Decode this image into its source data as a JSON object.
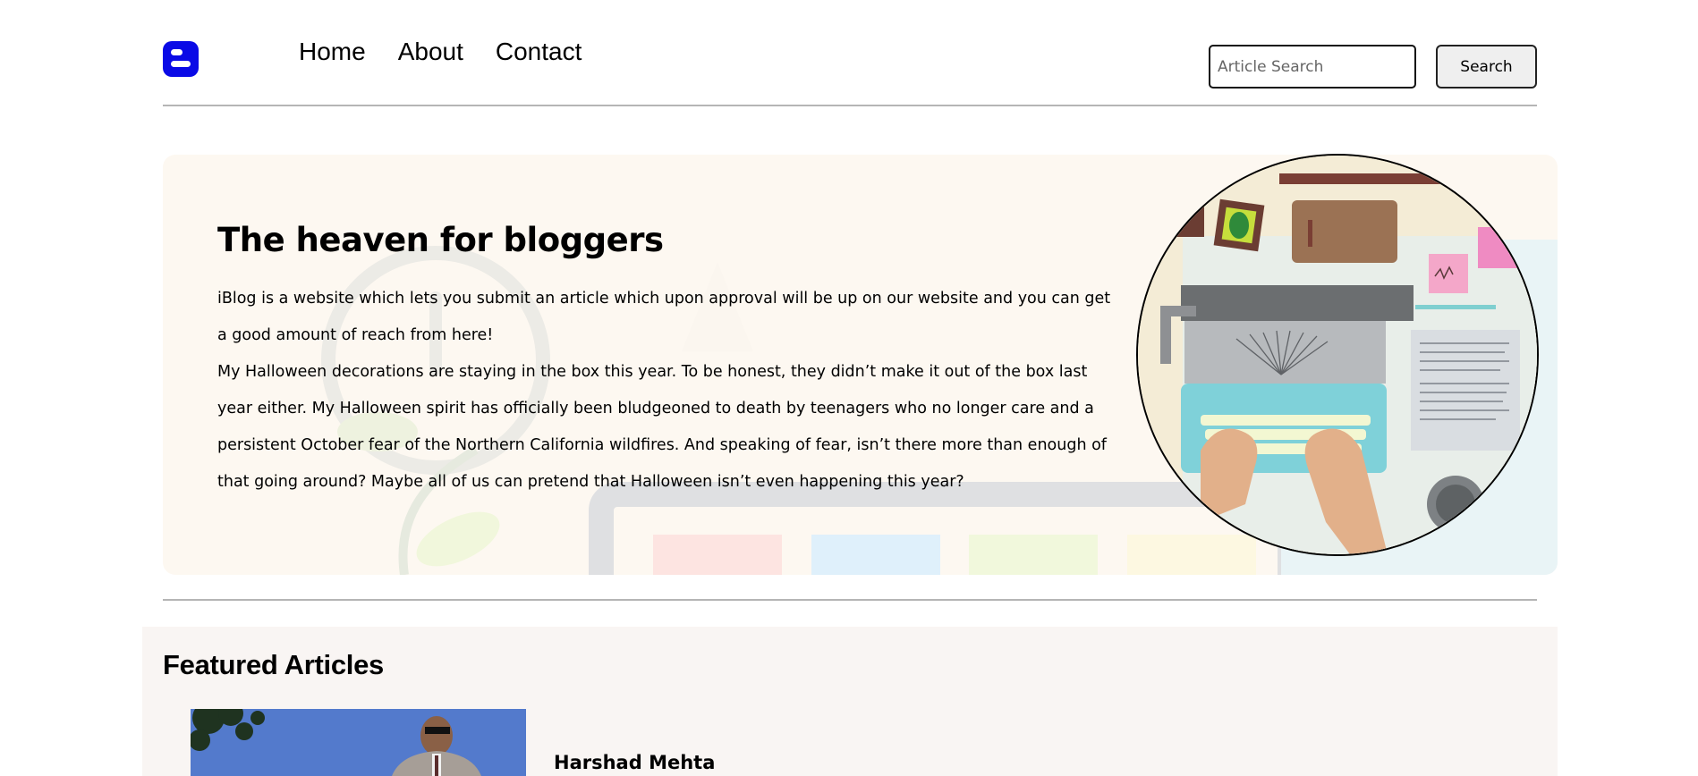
{
  "header": {
    "logo_icon": "blogger-logo-icon",
    "brand_color": "#0a0ae6",
    "nav": [
      {
        "label": "Home"
      },
      {
        "label": "About"
      },
      {
        "label": "Contact"
      }
    ],
    "search": {
      "placeholder": "Article Search",
      "button_label": "Search"
    }
  },
  "hero": {
    "title": "The heaven for bloggers",
    "paragraphs": [
      "iBlog is a website which lets you submit an article which upon approval will be up on our website and you can get a good amount of reach from here!",
      "My Halloween decorations are staying in the box this year. To be honest, they didn’t make it out of the box last year either. My Halloween spirit has officially been bludgeoned to death by teenagers who no longer care and a persistent October fear of the Northern California wildfires. And speaking of fear, isn’t there more than enough of that going around? Maybe all of us can pretend that Halloween isn’t even happening this year?"
    ],
    "image": "typewriter-desk-illustration",
    "background_color": "#fdf8f1"
  },
  "featured": {
    "title": "Featured Articles",
    "articles": [
      {
        "name": "Harshad Mehta",
        "image": "person-photo"
      }
    ]
  }
}
